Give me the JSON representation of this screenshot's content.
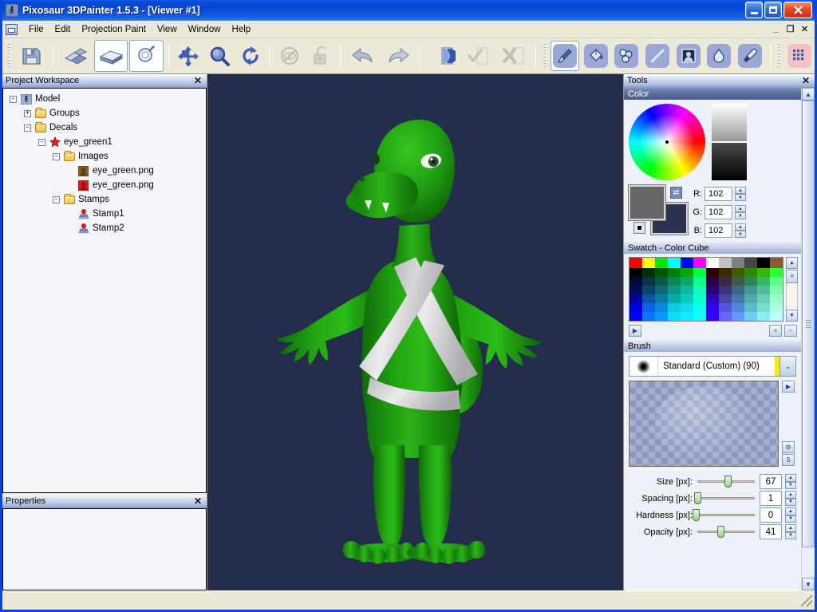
{
  "window": {
    "title": "Pixosaur 3DPainter 1.5.3 - [Viewer #1]",
    "app_icon": "app-icon",
    "minimize_label": "_",
    "maximize_label": "□",
    "close_label": "✕"
  },
  "menu": {
    "items": [
      {
        "label": "File"
      },
      {
        "label": "Edit"
      },
      {
        "label": "Projection Paint"
      },
      {
        "label": "View"
      },
      {
        "label": "Window"
      },
      {
        "label": "Help"
      }
    ],
    "mdi_buttons": [
      {
        "label": "_",
        "name": "mdi-minimize"
      },
      {
        "label": "❐",
        "name": "mdi-restore"
      },
      {
        "label": "✕",
        "name": "mdi-close"
      }
    ]
  },
  "toolbar": {
    "groups": [
      {
        "name": "file-group",
        "buttons": [
          {
            "name": "save-button",
            "icon": "floppy-disk-icon",
            "selected": false
          }
        ]
      },
      {
        "name": "view-mode-group",
        "buttons": [
          {
            "name": "unfold-uv-button",
            "icon": "unfold-uv-icon",
            "selected": false
          },
          {
            "name": "flat-view-button",
            "icon": "flat-plane-icon",
            "selected": true
          },
          {
            "name": "light-probe-button",
            "icon": "light-bulb-icon",
            "selected": true
          }
        ]
      },
      {
        "name": "navigation-group",
        "buttons": [
          {
            "name": "pan-button",
            "icon": "move-arrows-icon",
            "selected": false
          },
          {
            "name": "zoom-button",
            "icon": "magnifier-icon",
            "selected": false
          },
          {
            "name": "rotate-button",
            "icon": "rotate-icon",
            "selected": false
          }
        ]
      },
      {
        "name": "visibility-group",
        "buttons": [
          {
            "name": "hide-button",
            "icon": "hide-eye-icon",
            "selected": false,
            "disabled": true
          },
          {
            "name": "lock-button",
            "icon": "padlock-icon",
            "selected": false,
            "disabled": true
          }
        ]
      },
      {
        "name": "history-group",
        "buttons": [
          {
            "name": "undo-button",
            "icon": "undo-arrow-icon",
            "selected": false
          },
          {
            "name": "redo-button",
            "icon": "redo-arrow-icon",
            "selected": false
          }
        ]
      },
      {
        "name": "projection-group",
        "buttons": [
          {
            "name": "begin-projection-button",
            "icon": "sphere-plane-icon",
            "selected": false
          },
          {
            "name": "apply-projection-button",
            "icon": "check-plane-icon",
            "selected": false,
            "disabled": true
          },
          {
            "name": "cancel-projection-button",
            "icon": "cross-plane-icon",
            "selected": false,
            "disabled": true
          }
        ]
      },
      {
        "name": "paint-tools-group",
        "buttons": [
          {
            "name": "brush-tool-button",
            "icon": "paint-brush-icon",
            "selected": true
          },
          {
            "name": "fill-tool-button",
            "icon": "paint-bucket-icon",
            "selected": false
          },
          {
            "name": "clone-tool-button",
            "icon": "clone-stamp-icon",
            "selected": false
          },
          {
            "name": "line-tool-button",
            "icon": "line-icon",
            "selected": false
          },
          {
            "name": "stamp-tool-button",
            "icon": "image-stamp-icon",
            "selected": false
          },
          {
            "name": "smudge-tool-button",
            "icon": "water-drop-icon",
            "selected": false
          },
          {
            "name": "eyedropper-tool-button",
            "icon": "eyedropper-icon",
            "selected": false
          }
        ]
      },
      {
        "name": "grid-group",
        "buttons": [
          {
            "name": "texture-grid-button",
            "icon": "grid-icon",
            "selected": false
          }
        ]
      }
    ]
  },
  "project_workspace": {
    "title": "Project Workspace",
    "close_label": "✕",
    "tree": [
      {
        "label": "Model",
        "depth": 0,
        "expander": "-",
        "icon": "model-figure-icon"
      },
      {
        "label": "Groups",
        "depth": 1,
        "expander": "+",
        "icon": "folder-icon"
      },
      {
        "label": "Decals",
        "depth": 1,
        "expander": "-",
        "icon": "folder-icon"
      },
      {
        "label": "eye_green1",
        "depth": 2,
        "expander": "-",
        "icon": "red-star-icon"
      },
      {
        "label": "Images",
        "depth": 3,
        "expander": "-",
        "icon": "folder-icon"
      },
      {
        "label": "eye_green.png",
        "depth": 4,
        "expander": "",
        "icon": "brown-image-icon"
      },
      {
        "label": "eye_green.png",
        "depth": 4,
        "expander": "",
        "icon": "red-image-icon"
      },
      {
        "label": "Stamps",
        "depth": 3,
        "expander": "-",
        "icon": "folder-icon"
      },
      {
        "label": "Stamp1",
        "depth": 4,
        "expander": "",
        "icon": "stamp-icon"
      },
      {
        "label": "Stamp2",
        "depth": 4,
        "expander": "",
        "icon": "stamp-icon"
      }
    ]
  },
  "properties": {
    "title": "Properties",
    "close_label": "✕",
    "content": ""
  },
  "viewport": {
    "name": "viewer-1",
    "background_color": "#242e4a",
    "model_name": "green-dinosaur-character",
    "model_color": "#1e9410",
    "strap_color": "#e2e2e2"
  },
  "tools": {
    "title": "Tools",
    "close_label": "✕",
    "color": {
      "title": "Color",
      "collapse_label": "⌃",
      "wheel_name": "hue-saturation-wheel",
      "marker_position": "center",
      "gradient_top": "#ffffff",
      "gradient_bottom": "#000000",
      "foreground_color": "#666666",
      "background_color": "#2a3450",
      "swap_label": "⇄",
      "default_label": "◼",
      "channels": [
        {
          "label": "R:",
          "value": "102"
        },
        {
          "label": "G:",
          "value": "102"
        },
        {
          "label": "B:",
          "value": "102"
        }
      ]
    },
    "swatch": {
      "title": "Swatch - Color Cube",
      "top_row": [
        "#ff0000",
        "#ffff00",
        "#00e800",
        "#00ffff",
        "#0000ff",
        "#ff00ff",
        "#ffffff",
        "#c0c0c0",
        "#808080",
        "#454545",
        "#000000",
        "#8b5a2b"
      ],
      "grid": [
        [
          "#000000",
          "#003300",
          "#005500",
          "#008000",
          "#00aa00",
          "#00ff44",
          "#330000",
          "#3a2a00",
          "#3e5c00",
          "#2e8800",
          "#37b800",
          "#2bff33"
        ],
        [
          "#000a33",
          "#0a3344",
          "#0a5a44",
          "#0a8855",
          "#0aaa66",
          "#0aff88",
          "#2a0044",
          "#3a2a44",
          "#3e5c44",
          "#2e8855",
          "#37b866",
          "#5cff88"
        ],
        [
          "#000a55",
          "#0a4466",
          "#0a6a77",
          "#0a9988",
          "#0abb99",
          "#0affbb",
          "#2a0077",
          "#3a3377",
          "#3e6688",
          "#3e9999",
          "#55bb99",
          "#7cffaa"
        ],
        [
          "#0000aa",
          "#0a55aa",
          "#0a7aaa",
          "#0aaaaa",
          "#0accbb",
          "#0affcc",
          "#3300bb",
          "#4444aa",
          "#4477aa",
          "#4faaaa",
          "#66ccbb",
          "#99ffcc"
        ],
        [
          "#0000dd",
          "#0a66dd",
          "#0a88dd",
          "#0accdd",
          "#0addee",
          "#0affee",
          "#3300ee",
          "#5555dd",
          "#5588dd",
          "#5fbbcc",
          "#77ddcc",
          "#aaffdd"
        ],
        [
          "#0000ff",
          "#0a77ff",
          "#0a99ff",
          "#0addff",
          "#0aeeff",
          "#0affff",
          "#3300ff",
          "#6666ff",
          "#6699ff",
          "#6fccee",
          "#88eeee",
          "#bbffff"
        ]
      ],
      "expand_label": "▶",
      "add_label": "+",
      "remove_label": "−"
    },
    "brush": {
      "title": "Brush",
      "preset_name": "Standard (Custom) (90)",
      "dropdown_label": "⌄",
      "preview_name": "brush-tip-preview",
      "sliders": [
        {
          "label": "Size [px]:",
          "value": "67",
          "percent": 52,
          "name": "size"
        },
        {
          "label": "Spacing [px]:",
          "value": "1",
          "percent": 2,
          "name": "spacing"
        },
        {
          "label": "Hardness [px]:",
          "value": "0",
          "percent": 0,
          "name": "hardness"
        },
        {
          "label": "Opacity [px]:",
          "value": "41",
          "percent": 41,
          "name": "opacity"
        }
      ],
      "spin_up": "▲",
      "spin_down": "▼"
    }
  },
  "statusbar": {
    "text": ""
  }
}
